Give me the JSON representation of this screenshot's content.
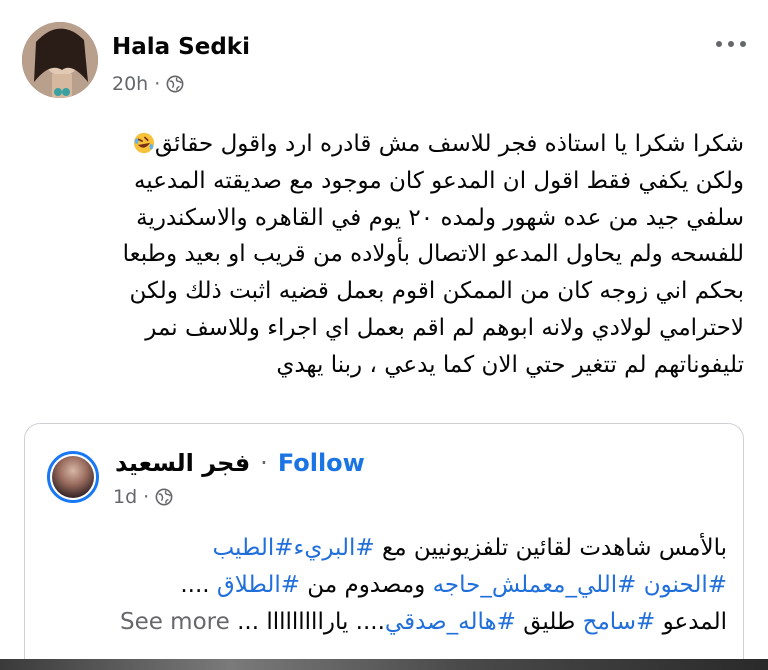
{
  "post": {
    "author": "Hala Sedki",
    "timestamp": "20h",
    "audience_icon": "globe-icon",
    "more_icon": "more-options-icon",
    "emoji_icon": "rolling-laughing-emoji",
    "text_lines": [
      "شكرا شكرا يا استاذه فجر للاسف مش قادره ارد واقول حقائق",
      "ولكن يكفي فقط اقول ان المدعو كان موجود مع صديقته المدعيه",
      "سلفي جيد من عده شهور ولمده ٢٠ يوم في القاهره والاسكندرية",
      "للفسحه ولم يحاول المدعو الاتصال بأولاده من قريب او بعيد وطبعا",
      "بحكم اني زوجه كان من الممكن اقوم بعمل قضيه اثبت ذلك ولكن",
      "لاحترامي لولادي ولانه ابوهم لم اقم بعمل اي اجراء وللاسف نمر",
      "تليفوناتهم لم تتغير حتي الان كما يدعي ، ربنا يهدي"
    ]
  },
  "shared_post": {
    "author": "فجر السعيد",
    "separator": "·",
    "follow_label": "Follow",
    "timestamp": "1d",
    "audience_icon": "globe-icon",
    "line1_text": "بالأمس شاهدت لقائين تلفزيونيين مع ",
    "line1_tag1": "#البريء",
    "line1_tag2": "#الطيب",
    "line2_tag1": "#الحنون",
    "line2_tag2": "#اللي_معملش_حاجه",
    "line2_text": " ومصدوم من ",
    "line2_tag3": "#الطلاق",
    "line2_end": " ....",
    "line3_text1": "المدعو ",
    "line3_tag1": "#سامح",
    "line3_text2": " طليق ",
    "line3_tag2": "#هاله_صدقي",
    "line3_text3": ".... يارااااااااا ...",
    "see_more_label": "See more"
  },
  "colors": {
    "link_blue": "#1b74e4",
    "hashtag_blue": "#216fdb",
    "meta_gray": "#65676b",
    "text_black": "#050505"
  }
}
